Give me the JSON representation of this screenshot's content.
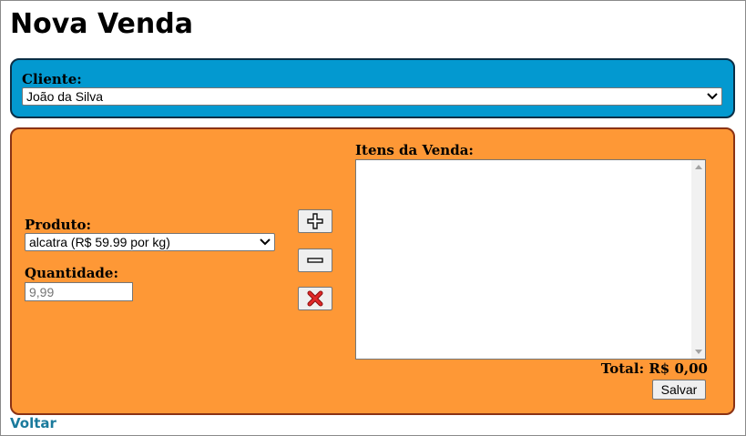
{
  "page": {
    "title": "Nova Venda"
  },
  "cliente": {
    "label": "Cliente:",
    "selected": "João da Silva"
  },
  "produto": {
    "label": "Produto:",
    "selected": "alcatra (R$ 59.99 por kg)"
  },
  "quantidade": {
    "label": "Quantidade:",
    "placeholder": "9,99",
    "value": ""
  },
  "actions": {
    "add_icon": "plus-icon",
    "remove_icon": "minus-icon",
    "delete_icon": "close-icon"
  },
  "itens": {
    "label": "Itens da Venda:",
    "items": []
  },
  "total": {
    "text": "Total: R$ 0,00"
  },
  "buttons": {
    "salvar": "Salvar"
  },
  "links": {
    "voltar": "Voltar"
  },
  "colors": {
    "cliente_panel": "#0399d0",
    "venda_panel": "#fe9836",
    "link": "#1a7a9c",
    "delete_icon": "#d12020"
  }
}
